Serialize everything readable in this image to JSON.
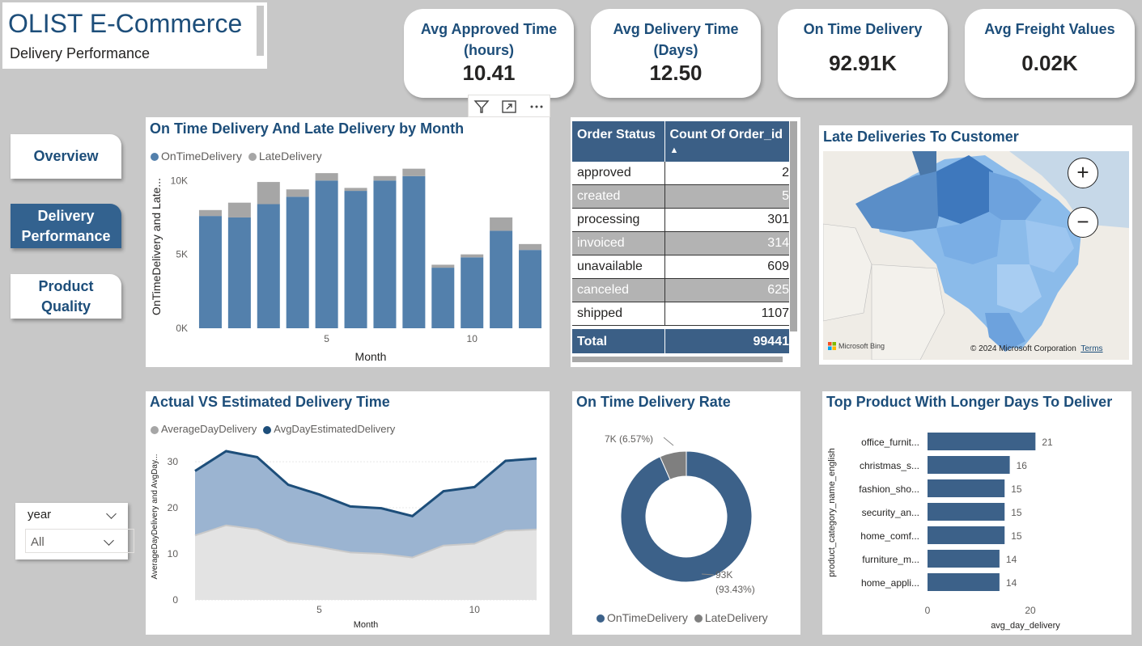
{
  "header": {
    "title": "OLIST E-Commerce",
    "subtitle": "Delivery Performance"
  },
  "kpis": [
    {
      "label_line1": "Avg Approved Time",
      "label_line2": "(hours)",
      "value": "10.41"
    },
    {
      "label_line1": "Avg Delivery Time",
      "label_line2": "(Days)",
      "value": "12.50"
    },
    {
      "label_line1": "On Time Delivery",
      "label_line2": "",
      "value": "92.91K"
    },
    {
      "label_line1": "Avg Freight Values",
      "label_line2": "",
      "value": "0.02K"
    }
  ],
  "nav": {
    "overview": "Overview",
    "delivery_line1": "Delivery",
    "delivery_line2": "Performance",
    "product_line1": "Product",
    "product_line2": "Quality"
  },
  "slicer": {
    "label": "year",
    "value": "All"
  },
  "colors": {
    "primary": "#5380ac",
    "late": "#a6a6a6",
    "title": "#1d4e7a",
    "navy": "#1d4e7a",
    "table_header": "#3b5f86"
  },
  "monthly_chart": {
    "title": "On Time Delivery And Late Delivery by Month",
    "legend": [
      "OnTimeDelivery",
      "LateDelivery"
    ],
    "ylabel": "OnTimeDelivery and Late...",
    "xlabel": "Month",
    "yticks": [
      "0K",
      "5K",
      "10K"
    ],
    "xticks": [
      "5",
      "10"
    ]
  },
  "order_table": {
    "headers": [
      "Order Status",
      "Count Of Order_id"
    ],
    "rows": [
      [
        "approved",
        "2"
      ],
      [
        "created",
        "5"
      ],
      [
        "processing",
        "301"
      ],
      [
        "invoiced",
        "314"
      ],
      [
        "unavailable",
        "609"
      ],
      [
        "canceled",
        "625"
      ],
      [
        "shipped",
        "1107"
      ]
    ],
    "total_label": "Total",
    "total_value": "99441"
  },
  "map": {
    "title": "Late Deliveries To Customer",
    "provider": "Microsoft Bing",
    "copyright": "© 2024 Microsoft Corporation",
    "terms": "Terms",
    "zoom_in": "+",
    "zoom_out": "−"
  },
  "area_chart": {
    "title": "Actual VS Estimated Delivery Time",
    "legend": [
      "AverageDayDelivery",
      "AvgDayEstimatedDelivery"
    ],
    "ylabel": "AverageDayDelivery and AvgDay...",
    "xlabel": "Month",
    "yticks": [
      "0",
      "10",
      "20",
      "30"
    ],
    "xticks": [
      "5",
      "10"
    ]
  },
  "donut": {
    "title": "On Time Delivery Rate",
    "late_label": "7K (6.57%)",
    "ontime_label_line1": "93K",
    "ontime_label_line2": "(93.43%)",
    "legend": [
      "OnTimeDelivery",
      "LateDelivery"
    ]
  },
  "bar_chart": {
    "title": "Top Product With Longer Days To Deliver",
    "ylabel": "product_category_name_english",
    "xlabel": "avg_day_delivery",
    "xticks": [
      "0",
      "20"
    ]
  },
  "chart_data": [
    {
      "type": "bar",
      "title": "On Time Delivery And Late Delivery by Month",
      "xlabel": "Month",
      "ylabel": "OnTimeDelivery and Late...",
      "categories": [
        1,
        2,
        3,
        4,
        5,
        6,
        7,
        8,
        9,
        10,
        11,
        12
      ],
      "ylim": [
        0,
        11000
      ],
      "series": [
        {
          "name": "OnTimeDelivery",
          "values": [
            7600,
            7500,
            8400,
            8900,
            10000,
            9300,
            10000,
            10300,
            4100,
            4800,
            6600,
            5300
          ]
        },
        {
          "name": "LateDelivery",
          "values": [
            400,
            1000,
            1500,
            500,
            500,
            200,
            300,
            500,
            200,
            200,
            900,
            400
          ]
        }
      ],
      "stacked": true,
      "legend": "top-left"
    },
    {
      "type": "area",
      "title": "Actual VS Estimated Delivery Time",
      "xlabel": "Month",
      "ylabel": "AverageDayDelivery and AvgDay...",
      "x": [
        1,
        2,
        3,
        4,
        5,
        6,
        7,
        8,
        9,
        10,
        11,
        12
      ],
      "ylim": [
        0,
        33
      ],
      "series": [
        {
          "name": "AverageDayDelivery",
          "values": [
            14.0,
            16.2,
            15.3,
            12.5,
            11.5,
            10.3,
            10.0,
            9.2,
            11.8,
            12.2,
            15.0,
            15.3
          ]
        },
        {
          "name": "AvgDayEstimatedDelivery",
          "values": [
            28.0,
            32.3,
            31.0,
            25.0,
            22.9,
            20.3,
            19.9,
            18.2,
            23.6,
            24.5,
            30.2,
            30.7
          ]
        }
      ],
      "legend": "top-left"
    },
    {
      "type": "pie",
      "title": "On Time Delivery Rate",
      "categories": [
        "OnTimeDelivery",
        "LateDelivery"
      ],
      "values": [
        93.43,
        6.57
      ],
      "donut": true,
      "legend": "bottom"
    },
    {
      "type": "bar",
      "orientation": "horizontal",
      "title": "Top Product With Longer Days To Deliver",
      "xlabel": "avg_day_delivery",
      "ylabel": "product_category_name_english",
      "categories": [
        "office_furnit...",
        "christmas_s...",
        "fashion_sho...",
        "security_an...",
        "home_comf...",
        "furniture_m...",
        "home_appli..."
      ],
      "values": [
        21,
        16,
        15,
        15,
        15,
        14,
        14
      ],
      "xlim": [
        0,
        22
      ]
    }
  ]
}
